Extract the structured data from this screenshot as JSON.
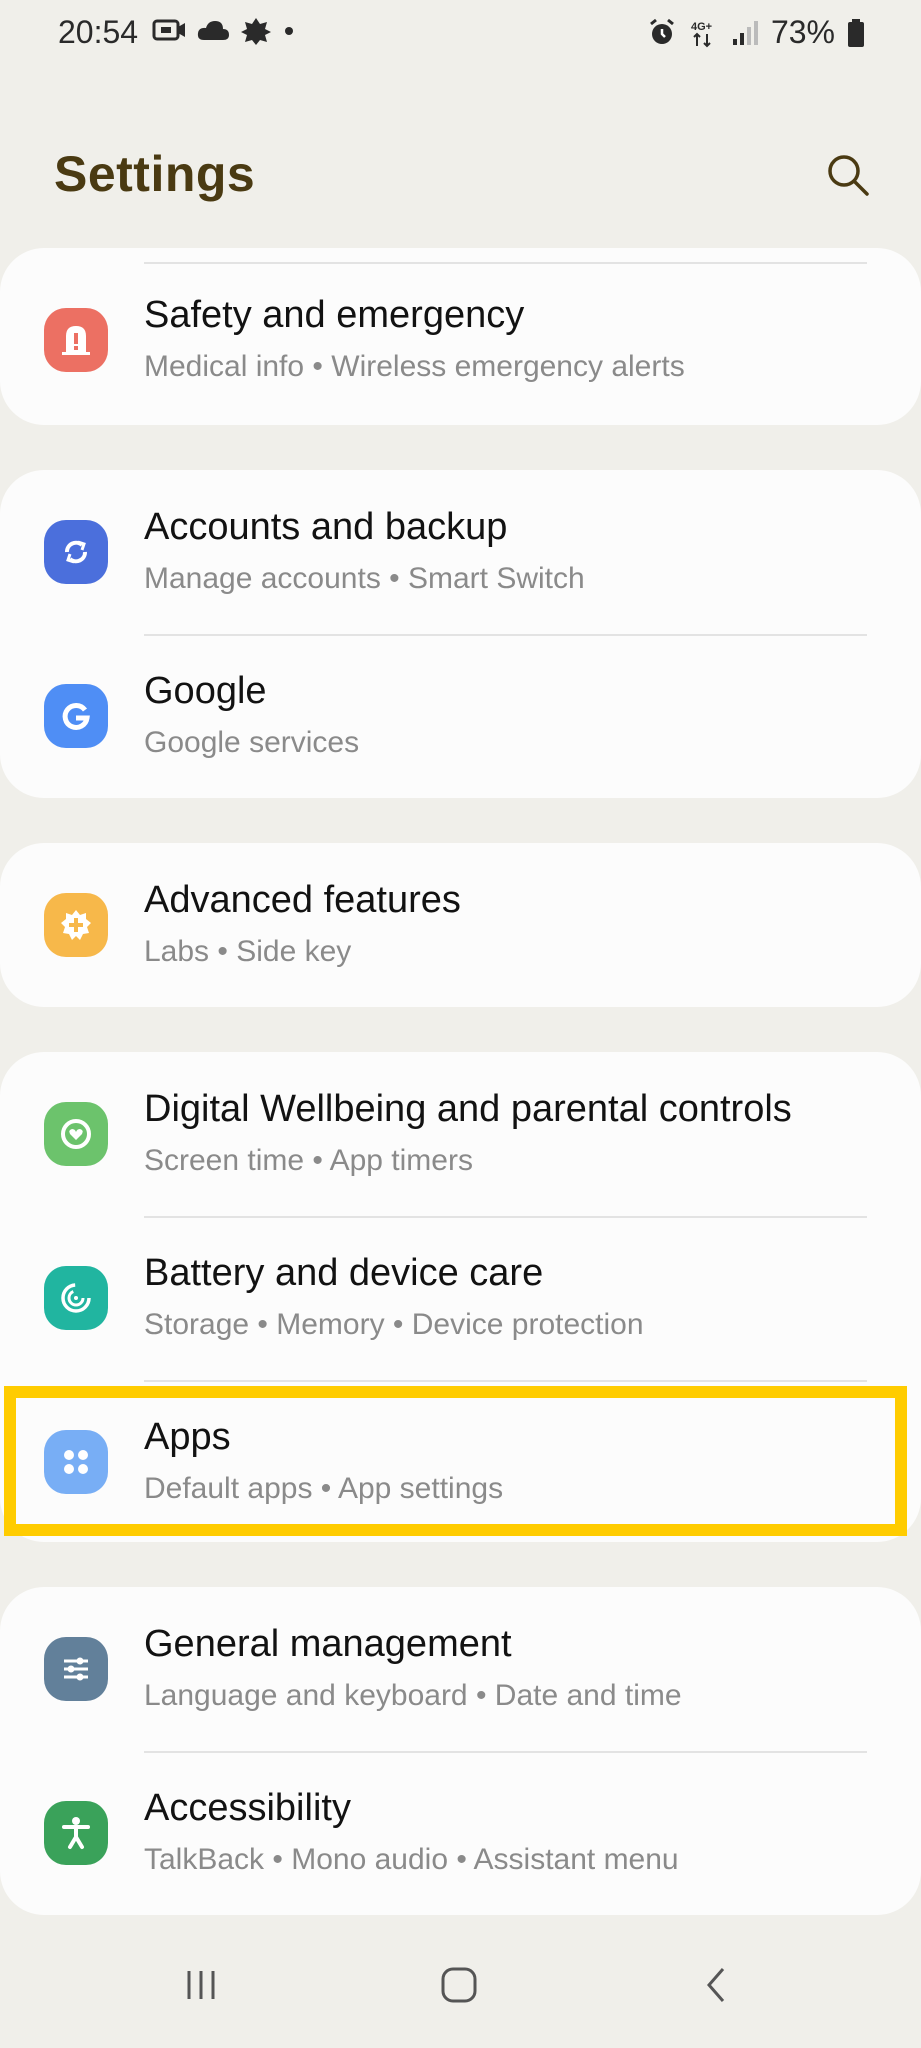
{
  "status_bar": {
    "time": "20:54",
    "battery": "73%",
    "icons_left": [
      "screen-record-icon",
      "cloud-icon",
      "leaf-icon",
      "dot-icon"
    ],
    "icons_right": [
      "alarm-icon",
      "network-4g-plus-icon",
      "signal-icon",
      "battery-icon"
    ]
  },
  "header": {
    "title": "Settings",
    "search_icon": "search-icon"
  },
  "cards": [
    {
      "items": [
        {
          "label": "Safety and emergency",
          "subtitle": "Medical info  •  Wireless emergency alerts",
          "icon": "warning-icon",
          "color": "#ec7063"
        }
      ]
    },
    {
      "items": [
        {
          "label": "Accounts and backup",
          "subtitle": "Manage accounts  •  Smart Switch",
          "icon": "sync-icon",
          "color": "#4b6fdc"
        },
        {
          "label": "Google",
          "subtitle": "Google services",
          "icon": "google-icon",
          "color": "#4f8ef5"
        }
      ]
    },
    {
      "items": [
        {
          "label": "Advanced features",
          "subtitle": "Labs  •  Side key",
          "icon": "puzzle-gear-icon",
          "color": "#f7b84a"
        }
      ]
    },
    {
      "items": [
        {
          "label": "Digital Wellbeing and parental controls",
          "subtitle": "Screen time  •  App timers",
          "icon": "wellbeing-heart-icon",
          "color": "#6cc36c"
        },
        {
          "label": "Battery and device care",
          "subtitle": "Storage  •  Memory  •  Device protection",
          "icon": "device-care-icon",
          "color": "#21b5a0"
        },
        {
          "label": "Apps",
          "subtitle": "Default apps  •  App settings",
          "icon": "apps-grid-icon",
          "color": "#78aef5"
        }
      ]
    },
    {
      "items": [
        {
          "label": "General management",
          "subtitle": "Language and keyboard  •  Date and time",
          "icon": "sliders-icon",
          "color": "#62809a"
        },
        {
          "label": "Accessibility",
          "subtitle": "TalkBack  •  Mono audio  •  Assistant menu",
          "icon": "accessibility-icon",
          "color": "#3aa25a"
        }
      ]
    }
  ],
  "highlighted_item": "Apps",
  "highlight_color": "#ffcc00",
  "nav_bar": {
    "recent_icon": "recent-apps-icon",
    "home_icon": "home-icon",
    "back_icon": "back-icon"
  }
}
